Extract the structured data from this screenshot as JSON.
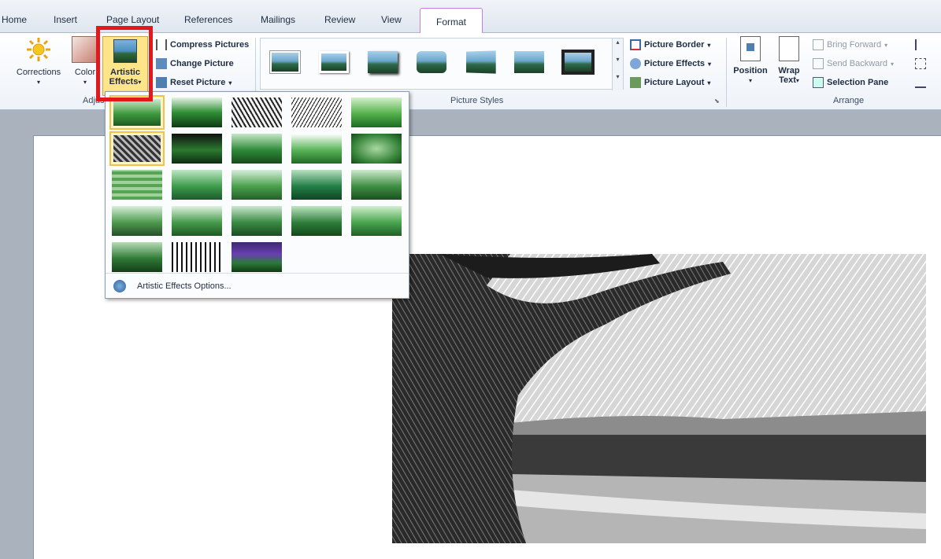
{
  "tabs": [
    "Home",
    "Insert",
    "Page Layout",
    "References",
    "Mailings",
    "Review",
    "View",
    "Format"
  ],
  "adjust": {
    "corrections": "Corrections",
    "color": "Color",
    "artistic_effects_line1": "Artistic",
    "artistic_effects_line2": "Effects",
    "compress": "Compress Pictures",
    "change": "Change Picture",
    "reset": "Reset Picture",
    "group_label": "Adjust"
  },
  "picture_styles": {
    "group_label": "Picture Styles",
    "border": "Picture Border",
    "effects": "Picture Effects",
    "layout": "Picture Layout"
  },
  "arrange": {
    "group_label": "Arrange",
    "position": "Position",
    "wrap_line1": "Wrap",
    "wrap_line2": "Text",
    "bring_forward": "Bring Forward",
    "send_backward": "Send Backward",
    "selection_pane": "Selection Pane"
  },
  "gallery": {
    "options_label": "Artistic Effects Options...",
    "effects": [
      "None",
      "Marker",
      "Pencil Grayscale",
      "Pencil Sketch",
      "Line Drawing",
      "Chalk Sketch",
      "Paint Strokes",
      "Paint Brush",
      "Glow Diffused",
      "Blur",
      "Light Screen",
      "Watercolor Sponge",
      "Film Grain",
      "Mosaic Bubbles",
      "Glass",
      "Cement",
      "Texturizer",
      "Crisscross Etching",
      "Pastels Smooth",
      "Plastic Wrap",
      "Cutout",
      "Photocopy",
      "Glow Edges"
    ]
  },
  "colors": {
    "accent": "#e1191f",
    "active_tab_border": "#c67de0"
  }
}
